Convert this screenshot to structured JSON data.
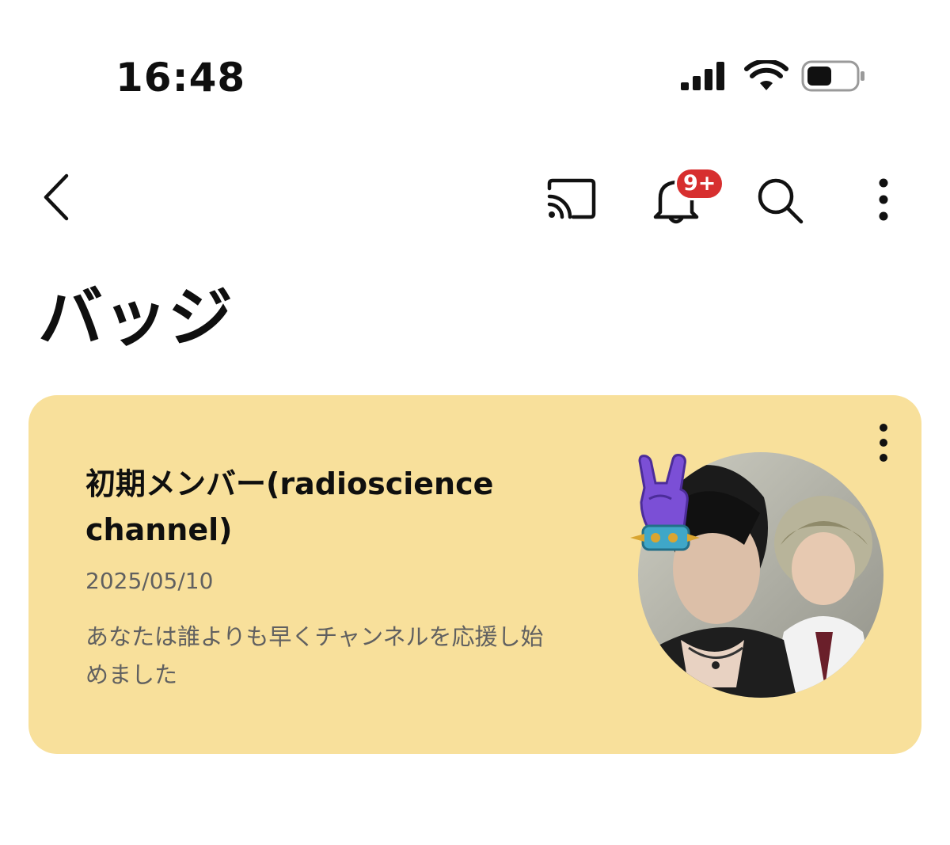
{
  "status_bar": {
    "time": "16:48",
    "signal_icon": "cellular-signal-icon",
    "wifi_icon": "wifi-icon",
    "battery_icon": "battery-icon"
  },
  "top_bar": {
    "back_icon": "chevron-left-icon",
    "cast_icon": "cast-icon",
    "notifications_icon": "bell-icon",
    "notifications_badge": "9+",
    "search_icon": "search-icon",
    "more_icon": "more-vertical-icon"
  },
  "page": {
    "title": "バッジ"
  },
  "badge_card": {
    "name": "初期メンバー(radioscience channel)",
    "date": "2025/05/10",
    "description": "あなたは誰よりも早くチャンネルを応援し始めました",
    "more_icon": "more-vertical-icon",
    "avatar": "channel-avatar-image",
    "sticker": "rock-hand-icon"
  },
  "colors": {
    "card_background": "#f8e09b",
    "badge_red": "#d72f2f",
    "secondary_text": "#606060",
    "sticker_purple": "#7b4fd6",
    "cuff_teal": "#3fa7c8"
  }
}
